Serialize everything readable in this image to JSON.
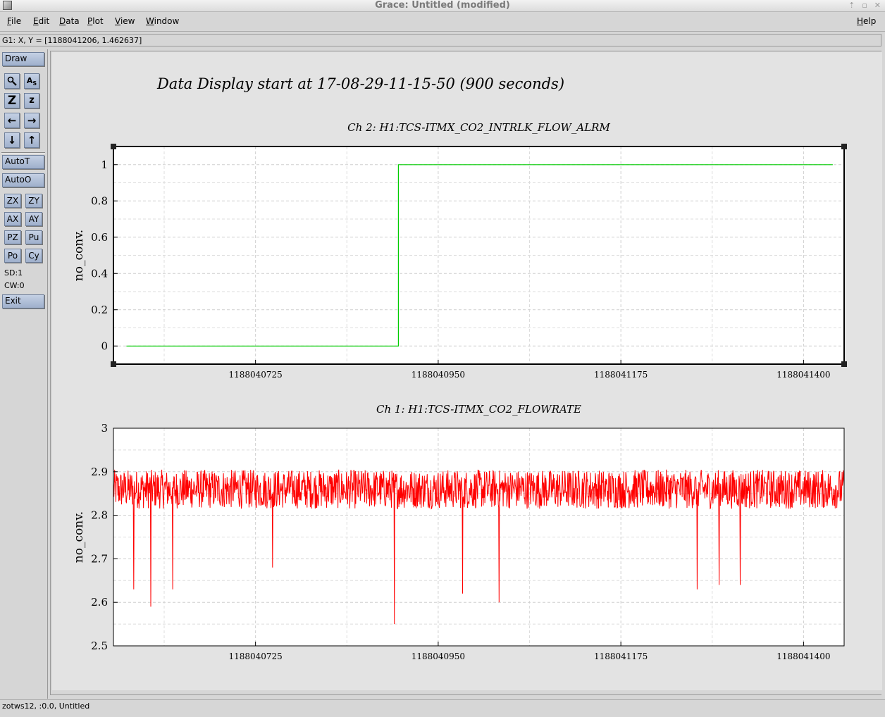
{
  "window": {
    "title": "Grace: Untitled (modified)"
  },
  "menu": {
    "items": [
      {
        "label": "File",
        "key": "F",
        "rest": "ile"
      },
      {
        "label": "Edit",
        "key": "E",
        "rest": "dit"
      },
      {
        "label": "Data",
        "key": "D",
        "rest": "ata"
      },
      {
        "label": "Plot",
        "key": "P",
        "rest": "lot"
      },
      {
        "label": "View",
        "key": "V",
        "rest": "iew"
      },
      {
        "label": "Window",
        "key": "W",
        "rest": "indow"
      }
    ],
    "help": {
      "label": "Help",
      "key": "H",
      "rest": "elp"
    }
  },
  "locator": "G1: X, Y = [1188041206, 1.462637]",
  "toolbar": {
    "draw": "Draw",
    "autot": "AutoT",
    "autoo": "AutoO",
    "zx": "ZX",
    "zy": "ZY",
    "ax": "AX",
    "ay": "AY",
    "pz": "PZ",
    "pu": "Pu",
    "po": "Po",
    "cy": "Cy",
    "sd": "SD:1",
    "cw": "CW:0",
    "exit": "Exit"
  },
  "status": "zotws12, :0.0, Untitled",
  "plot_title": "Data Display start at 17-08-29-11-15-50 (900 seconds)",
  "colors": {
    "series_top": "#00cc00",
    "series_bottom": "#ff0000",
    "button": "#aebcd6"
  },
  "chart_data": [
    {
      "type": "line",
      "title": "Ch 2: H1:TCS-ITMX_CO2_INTRLK_FLOW_ALRM",
      "ylabel": "no_conv.",
      "xlim": [
        1188040550,
        1188041450
      ],
      "ylim": [
        -0.1,
        1.1
      ],
      "x_ticks": [
        1188040725,
        1188040950,
        1188041175,
        1188041400
      ],
      "x_tick_labels": [
        "1188040725",
        "1188040950",
        "1188041175",
        "1188041400"
      ],
      "y_ticks": [
        0,
        0.2,
        0.4,
        0.6,
        0.8,
        1
      ],
      "y_tick_labels": [
        "0",
        "0.2",
        "0.4",
        "0.6",
        "0.8",
        "1"
      ],
      "grid": true,
      "series": [
        {
          "x": [
            1188040566,
            1188040901,
            1188040901,
            1188041436
          ],
          "values": [
            0,
            0,
            1,
            1
          ]
        }
      ]
    },
    {
      "type": "line",
      "title": "Ch 1: H1:TCS-ITMX_CO2_FLOWRATE",
      "ylabel": "no_conv.",
      "xlim": [
        1188040550,
        1188041450
      ],
      "ylim": [
        2.5,
        3.0
      ],
      "x_ticks": [
        1188040725,
        1188040950,
        1188041175,
        1188041400
      ],
      "x_tick_labels": [
        "1188040725",
        "1188040950",
        "1188041175",
        "1188041400"
      ],
      "y_ticks": [
        2.5,
        2.6,
        2.7,
        2.8,
        2.9,
        3
      ],
      "y_tick_labels": [
        "2.5",
        "2.6",
        "2.7",
        "2.8",
        "2.9",
        "3"
      ],
      "grid": true,
      "series": [
        {
          "baseline": 2.86,
          "noise_amplitude": 0.05,
          "dips": [
            {
              "x": 1188040575,
              "y": 2.63
            },
            {
              "x": 1188040596,
              "y": 2.59
            },
            {
              "x": 1188040623,
              "y": 2.63
            },
            {
              "x": 1188040746,
              "y": 2.68
            },
            {
              "x": 1188040896,
              "y": 2.55
            },
            {
              "x": 1188040980,
              "y": 2.62
            },
            {
              "x": 1188041025,
              "y": 2.6
            },
            {
              "x": 1188041269,
              "y": 2.63
            },
            {
              "x": 1188041296,
              "y": 2.64
            },
            {
              "x": 1188041322,
              "y": 2.64
            }
          ]
        }
      ]
    }
  ]
}
